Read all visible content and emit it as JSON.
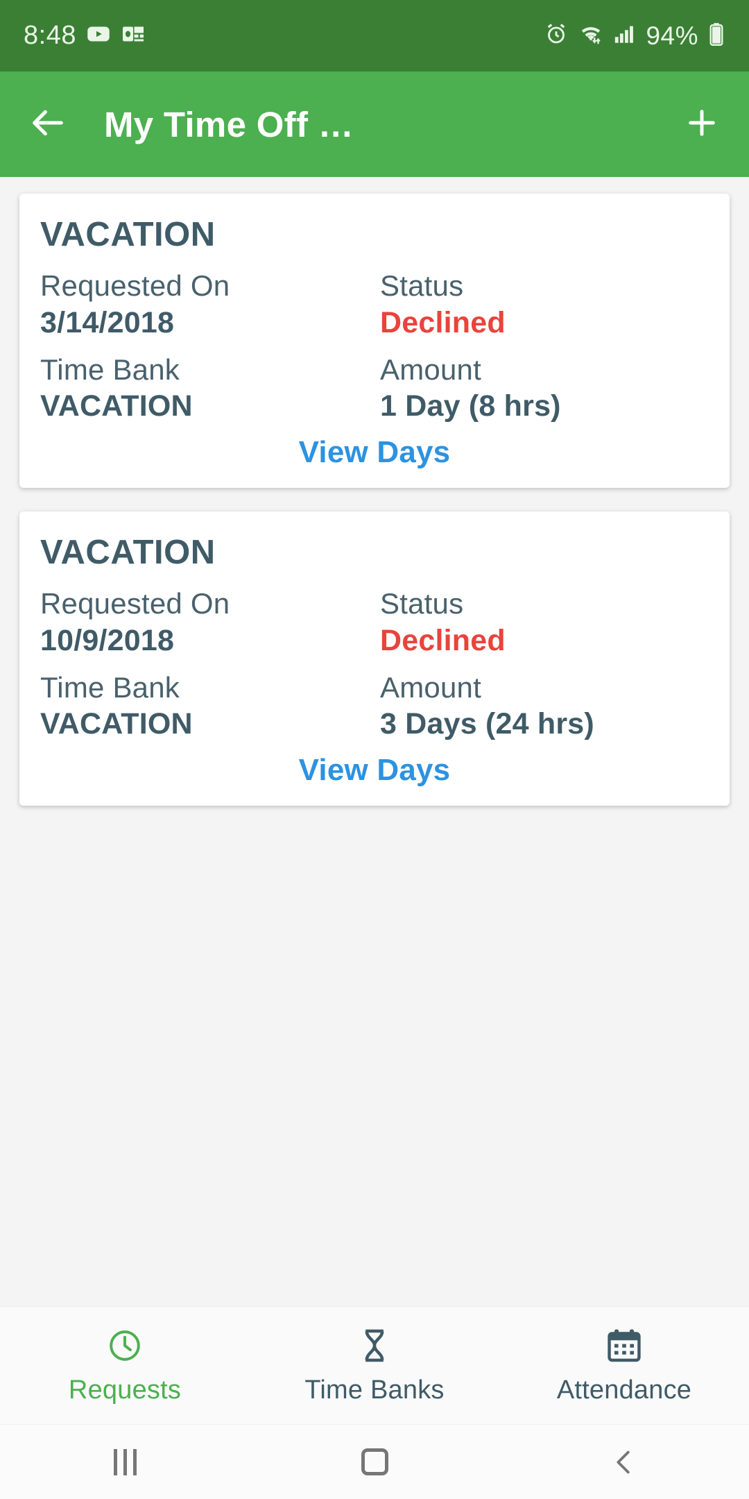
{
  "status_bar": {
    "time": "8:48",
    "battery_percent": "94%",
    "icons": [
      "youtube-icon",
      "outlook-icon",
      "alarm-icon",
      "wifi-icon",
      "cellular-signal-icon",
      "battery-icon"
    ],
    "background_color": "#3b7f35"
  },
  "app_bar": {
    "title": "My Time Off …",
    "back_icon": "back-arrow-icon",
    "add_icon": "plus-icon",
    "background_color": "#4caf50"
  },
  "requests": [
    {
      "title": "VACATION",
      "requested_on_label": "Requested On",
      "requested_on_value": "3/14/2018",
      "status_label": "Status",
      "status_value": "Declined",
      "status_color": "#e8443c",
      "time_bank_label": "Time Bank",
      "time_bank_value": "VACATION",
      "amount_label": "Amount",
      "amount_value": "1 Day (8 hrs)",
      "view_days_label": "View Days"
    },
    {
      "title": "VACATION",
      "requested_on_label": "Requested On",
      "requested_on_value": "10/9/2018",
      "status_label": "Status",
      "status_value": "Declined",
      "status_color": "#e8443c",
      "time_bank_label": "Time Bank",
      "time_bank_value": "VACATION",
      "amount_label": "Amount",
      "amount_value": "3 Days (24 hrs)",
      "view_days_label": "View Days"
    }
  ],
  "tabs": [
    {
      "label": "Requests",
      "icon": "clock-icon",
      "active": true
    },
    {
      "label": "Time Banks",
      "icon": "hourglass-icon",
      "active": false
    },
    {
      "label": "Attendance",
      "icon": "calendar-icon",
      "active": false
    }
  ],
  "nav_bar": {
    "recents_icon": "recents-icon",
    "home_icon": "home-icon",
    "back_icon": "back-chevron-icon"
  },
  "colors": {
    "accent_green": "#4caf50",
    "status_bar_green": "#3b7f35",
    "link_blue": "#2d92e0",
    "text_slate": "#3f5b67",
    "declined_red": "#e8443c"
  }
}
